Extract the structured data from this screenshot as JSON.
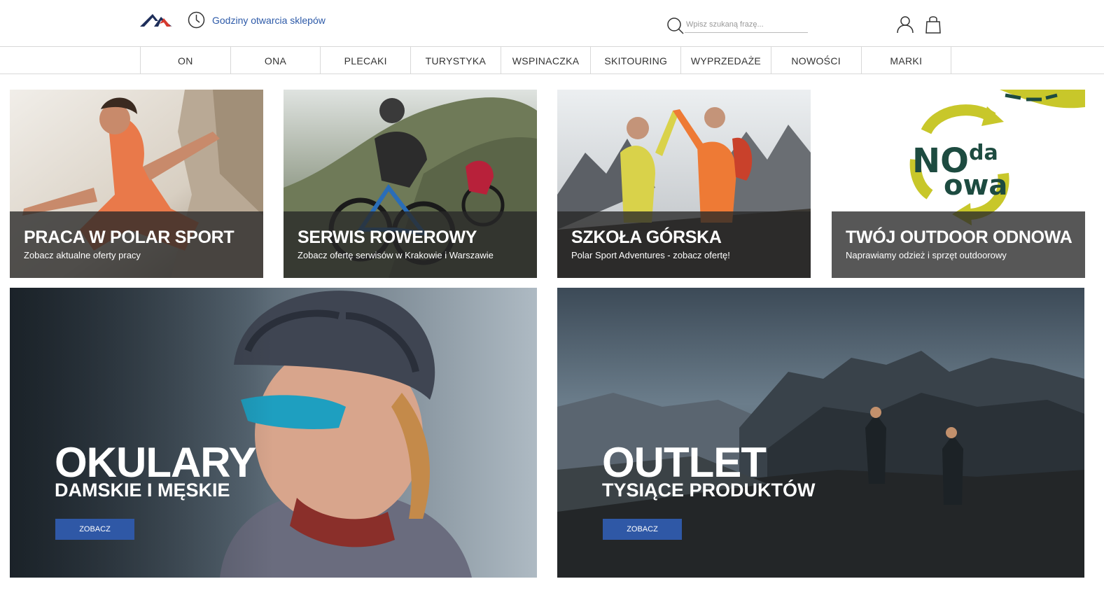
{
  "header": {
    "logo_icon": "mountain-logo-icon",
    "hours_icon": "clock-icon",
    "hours_label": "Godziny otwarcia sklepów",
    "search_placeholder": "Wpisz szukaną frazę...",
    "search_icon": "search-icon",
    "user_icon": "user-icon",
    "bag_icon": "shopping-bag-icon"
  },
  "nav": {
    "items": [
      "ON",
      "ONA",
      "PLECAKI",
      "TURYSTYKA",
      "WSPINACZKA",
      "SKITOURING",
      "WYPRZEDAŻE",
      "NOWOŚCI",
      "MARKI"
    ]
  },
  "tiles": [
    {
      "title": "PRACA W POLAR SPORT",
      "subtitle": "Zobacz aktualne oferty pracy"
    },
    {
      "title": "SERWIS ROWEROWY",
      "subtitle": "Zobacz ofertę serwisów w Krakowie i Warszawie"
    },
    {
      "title": "SZKOŁA GÓRSKA",
      "subtitle": "Polar Sport Adventures - zobacz ofertę!"
    },
    {
      "title": "TWÓJ OUTDOOR ODNOWA",
      "subtitle": "Naprawiamy odzież i sprzęt outdoorowy",
      "logo_text": "NOda Nowa"
    }
  ],
  "banners": [
    {
      "title": "OKULARY",
      "subtitle": "DAMSKIE I MĘSKIE",
      "button": "ZOBACZ"
    },
    {
      "title": "OUTLET",
      "subtitle": "TYSIĄCE PRODUKTÓW",
      "button": "ZOBACZ"
    }
  ],
  "colors": {
    "accent_blue": "#2f58a6",
    "logo_red": "#d63a2f",
    "logo_navy": "#1e2e5a",
    "odnowa_green": "#1d4b40",
    "odnowa_yellow": "#c8c72a"
  }
}
